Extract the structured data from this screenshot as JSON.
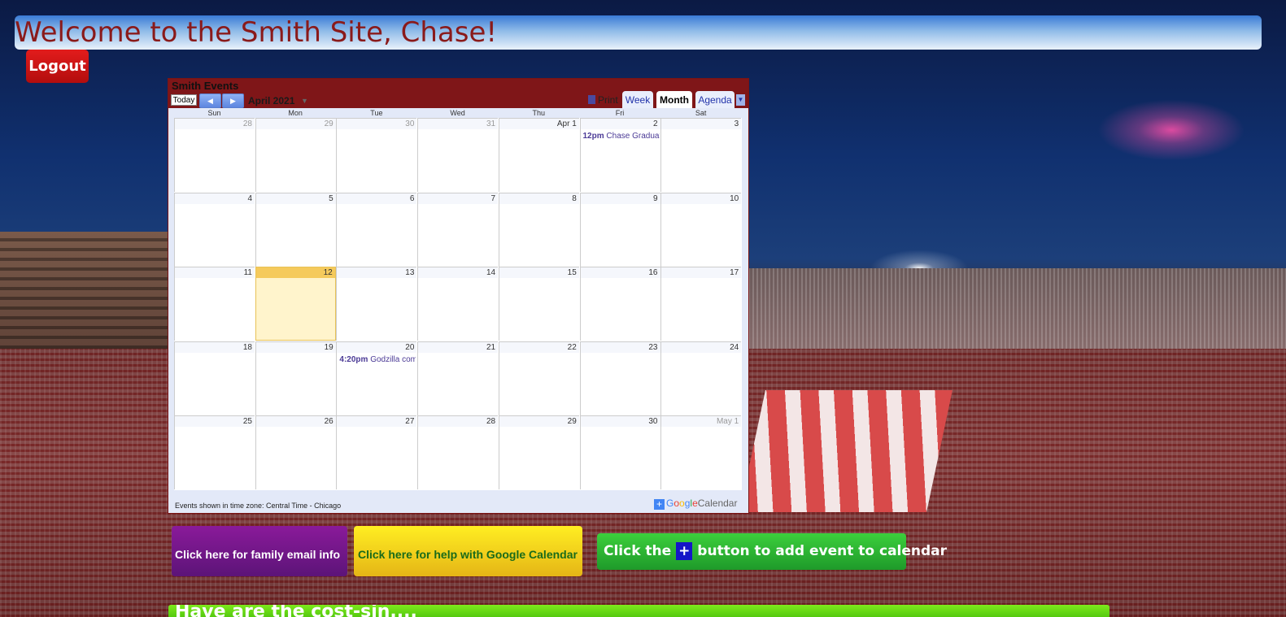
{
  "header": {
    "welcome": "Welcome to the Smith Site, Chase!",
    "logout_label": "Logout"
  },
  "calendar": {
    "title": "Smith Events",
    "today_label": "Today",
    "prev_icon": "chevron-left-icon",
    "next_icon": "chevron-right-icon",
    "month_label": "April 2021",
    "print_label": "Print",
    "tabs": [
      {
        "label": "Week",
        "active": false
      },
      {
        "label": "Month",
        "active": true
      },
      {
        "label": "Agenda",
        "active": false
      }
    ],
    "weekdays": [
      "Sun",
      "Mon",
      "Tue",
      "Wed",
      "Thu",
      "Fri",
      "Sat"
    ],
    "weeks": [
      [
        "28",
        "29",
        "30",
        "31",
        "Apr 1",
        "2",
        "3"
      ],
      [
        "4",
        "5",
        "6",
        "7",
        "8",
        "9",
        "10"
      ],
      [
        "11",
        "12",
        "13",
        "14",
        "15",
        "16",
        "17"
      ],
      [
        "18",
        "19",
        "20",
        "21",
        "22",
        "23",
        "24"
      ],
      [
        "25",
        "26",
        "27",
        "28",
        "29",
        "30",
        "May 1"
      ]
    ],
    "events": [
      {
        "week": 0,
        "day": 5,
        "time": "12pm",
        "title": "Chase Graduat"
      },
      {
        "week": 3,
        "day": 2,
        "time": "4:20pm",
        "title": "Godzilla com"
      }
    ],
    "timezone_note": "Events shown in time zone: Central Time - Chicago",
    "google_calendar_label": {
      "google": "Google",
      "calendar": "Calendar"
    }
  },
  "buttons": {
    "email": "Click here for family email info",
    "help": "Click here for help with Google Calendar",
    "add_note_pre": "Click the",
    "add_note_plus": "+",
    "add_note_post": "button to add event to calendar"
  },
  "bottom_bar_text": "Have are the cost-sin...."
}
